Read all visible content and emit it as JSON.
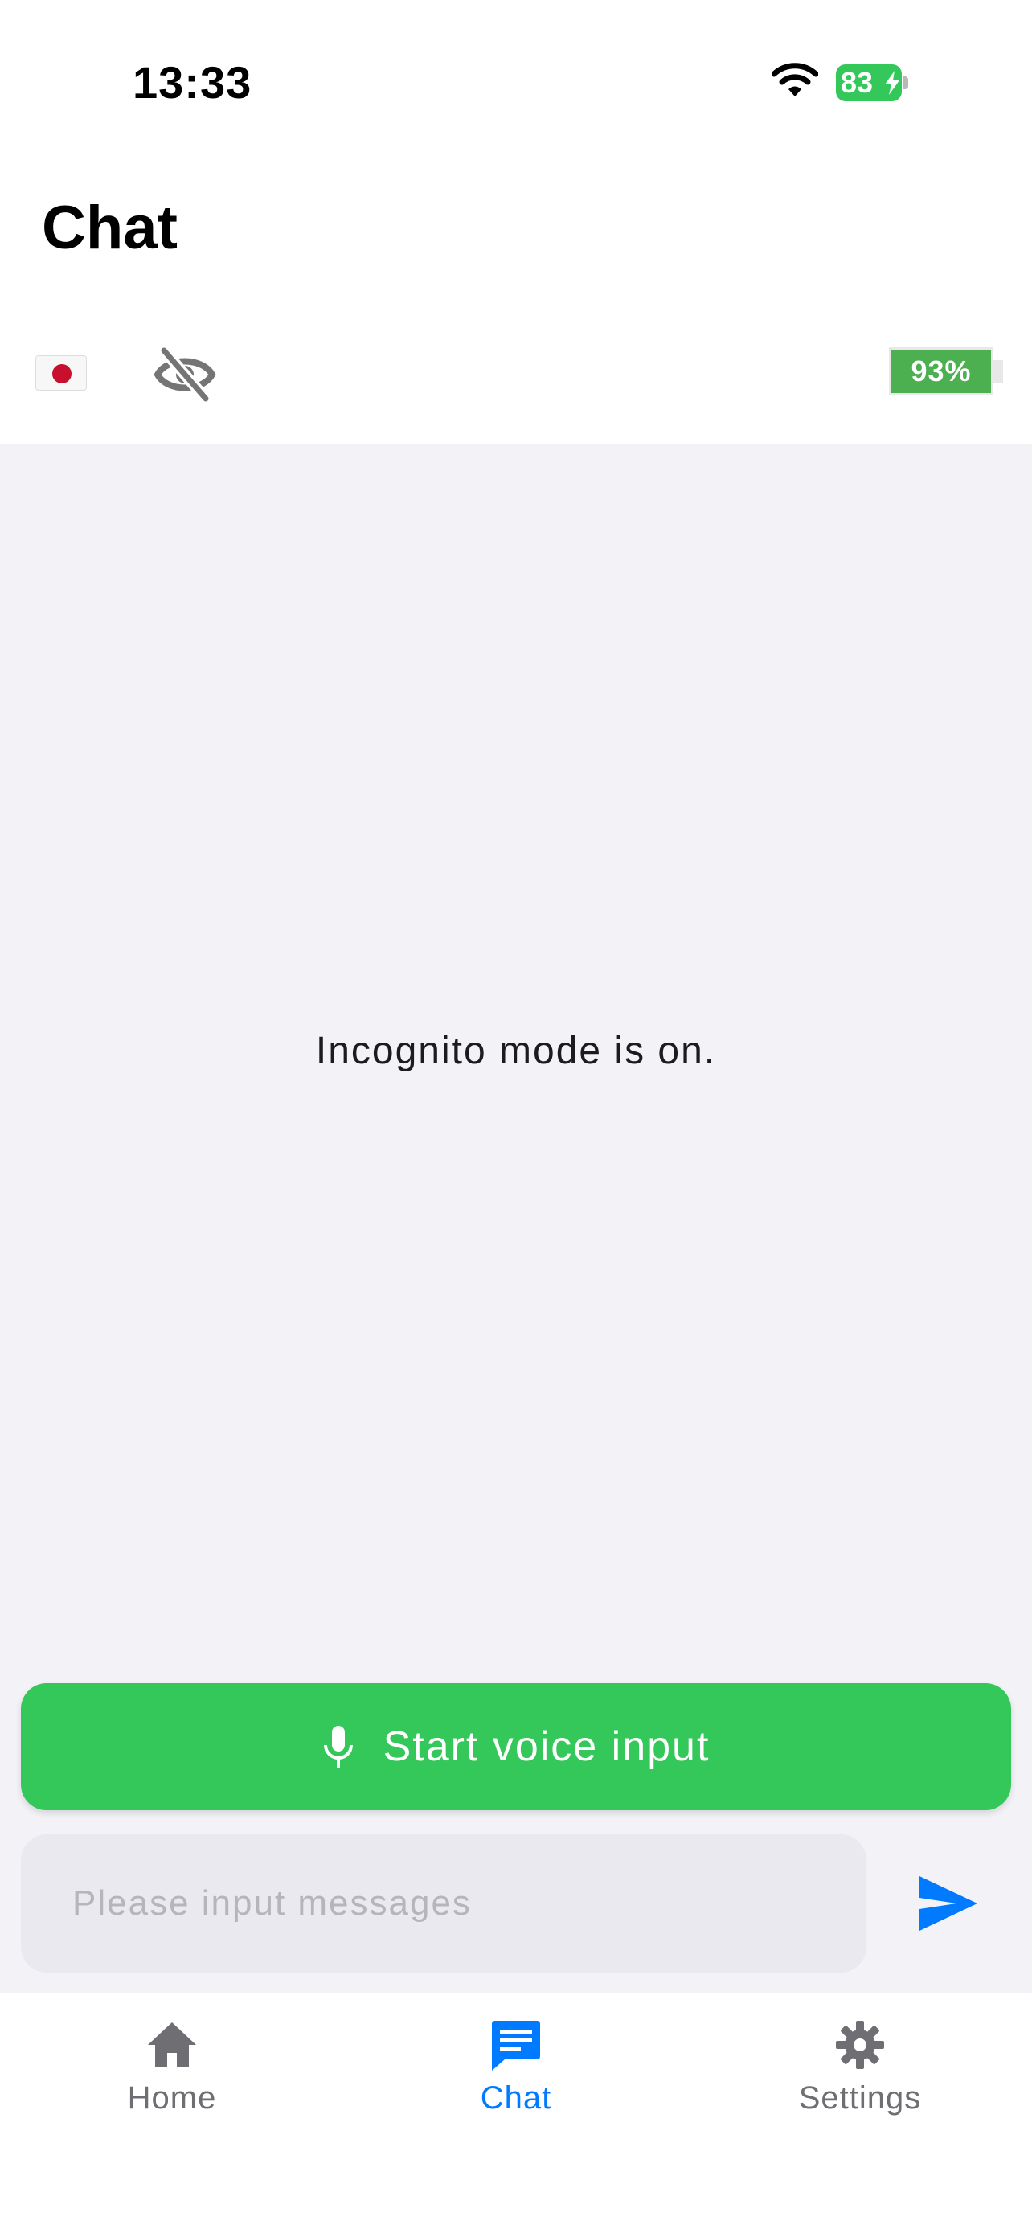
{
  "status_bar": {
    "time": "13:33",
    "battery_level": "83"
  },
  "header": {
    "title": "Chat"
  },
  "toolbar": {
    "language_icon": "japan-flag-icon",
    "incognito_icon": "eye-slash-icon",
    "battery_level": "93%"
  },
  "chat": {
    "incognito_message": "Incognito mode is on."
  },
  "voice": {
    "label": "Start voice input"
  },
  "input": {
    "value": "",
    "placeholder": "Please input messages"
  },
  "tabs": [
    {
      "label": "Home",
      "icon": "home-icon",
      "active": false
    },
    {
      "label": "Chat",
      "icon": "chat-icon",
      "active": true
    },
    {
      "label": "Settings",
      "icon": "gear-icon",
      "active": false
    }
  ],
  "colors": {
    "accent": "#007aff",
    "voice_button": "#34c759",
    "battery_green": "#4caf50",
    "chat_background": "#f2f2f7"
  }
}
